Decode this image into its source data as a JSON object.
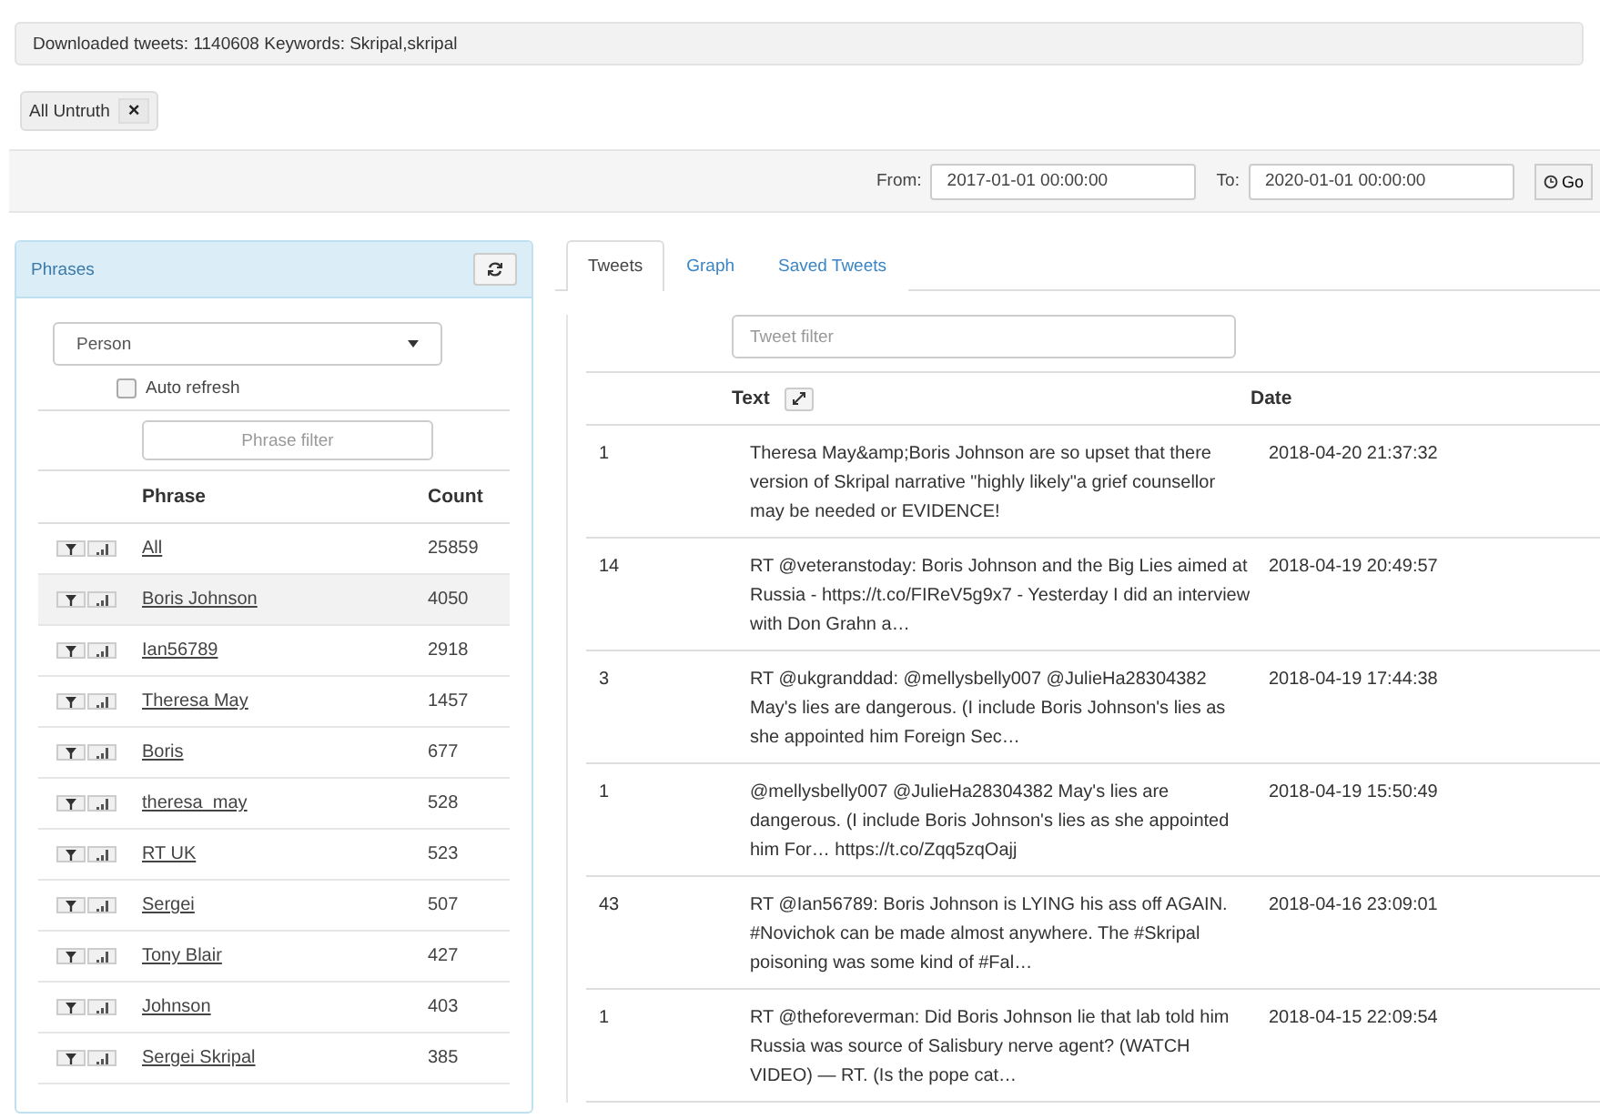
{
  "info_bar": {
    "text": "Downloaded tweets: 1140608 Keywords: Skripal,skripal"
  },
  "filter_tags": [
    {
      "label": "All Untruth",
      "remove": "×"
    }
  ],
  "date_range": {
    "from_label": "From:",
    "from_value": "2017-01-01 00:00:00",
    "to_label": "To:",
    "to_value": "2020-01-01 00:00:00",
    "go_label": "Go"
  },
  "phrases_panel": {
    "title": "Phrases",
    "category": "Person",
    "auto_refresh": {
      "label": "Auto refresh",
      "checked": false
    },
    "filter_placeholder": "Phrase filter",
    "columns": [
      "Phrase",
      "Count"
    ],
    "rows": [
      {
        "phrase": "All",
        "count": "25859",
        "selected": false
      },
      {
        "phrase": "Boris Johnson",
        "count": "4050",
        "selected": true
      },
      {
        "phrase": "Ian56789",
        "count": "2918",
        "selected": false
      },
      {
        "phrase": "Theresa May",
        "count": "1457",
        "selected": false
      },
      {
        "phrase": "Boris",
        "count": "677",
        "selected": false
      },
      {
        "phrase": "theresa_may",
        "count": "528",
        "selected": false
      },
      {
        "phrase": "RT UK",
        "count": "523",
        "selected": false
      },
      {
        "phrase": "Sergei",
        "count": "507",
        "selected": false
      },
      {
        "phrase": "Tony Blair",
        "count": "427",
        "selected": false
      },
      {
        "phrase": "Johnson",
        "count": "403",
        "selected": false
      },
      {
        "phrase": "Sergei Skripal",
        "count": "385",
        "selected": false
      }
    ]
  },
  "tabs": [
    {
      "label": "Tweets",
      "selected": true
    },
    {
      "label": "Graph",
      "selected": false
    },
    {
      "label": "Saved Tweets",
      "selected": false
    }
  ],
  "tweets": {
    "filter_placeholder": "Tweet filter",
    "columns": [
      "Text",
      "Date"
    ],
    "rows": [
      {
        "count": "1",
        "text": "Theresa May&amp;Boris Johnson are so upset that there version of Skripal narrative \"highly likely\"a grief counsellor may be needed or EVIDENCE!",
        "date": "2018-04-20 21:37:32"
      },
      {
        "count": "14",
        "text": "RT @veteranstoday: Boris Johnson and the Big Lies aimed at Russia - https://t.co/FIReV5g9x7 - Yesterday I did an interview with Don Grahn a…",
        "date": "2018-04-19 20:49:57"
      },
      {
        "count": "3",
        "text": "RT @ukgranddad: @mellysbelly007 @JulieHa28304382 May's lies are dangerous. (I include Boris Johnson's lies as she appointed him Foreign Sec…",
        "date": "2018-04-19 17:44:38"
      },
      {
        "count": "1",
        "text": "@mellysbelly007 @JulieHa28304382 May's lies are dangerous. (I include Boris Johnson's lies as she appointed him For… https://t.co/Zqq5zqOajj",
        "date": "2018-04-19 15:50:49"
      },
      {
        "count": "43",
        "text": "RT @Ian56789: Boris Johnson is LYING his ass off AGAIN. #Novichok can be made almost anywhere. The #Skripal poisoning was some kind of #Fal…",
        "date": "2018-04-16 23:09:01"
      },
      {
        "count": "1",
        "text": "RT @theforeverman: Did Boris Johnson lie that lab told him Russia was source of Salisbury nerve agent? (WATCH VIDEO) — RT. (Is the pope cat…",
        "date": "2018-04-15 22:09:54"
      }
    ]
  }
}
